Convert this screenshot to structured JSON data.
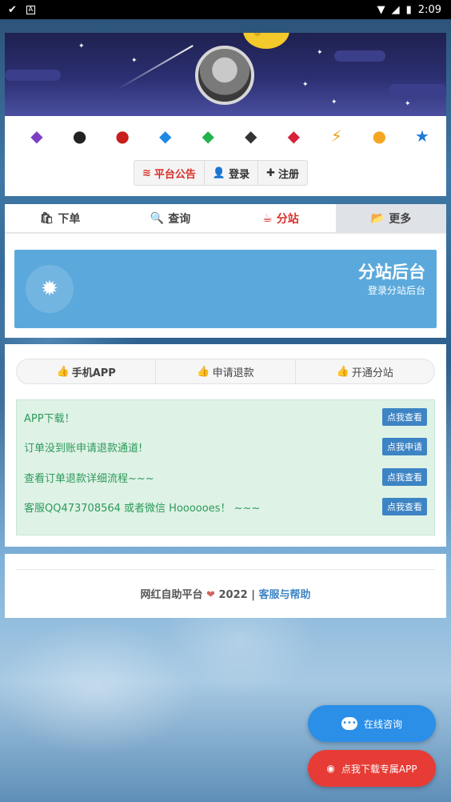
{
  "status_bar": {
    "time": "2:09"
  },
  "icons": {
    "qq_badges": [
      "qq-flame-icon",
      "qq-penguin-icon",
      "qq-red-penguin-icon",
      "superman-diamond-icon",
      "green-diamond-icon",
      "black-diamond-icon",
      "red-diamond-icon",
      "lightning-icon",
      "music-icon",
      "blue-star-icon"
    ]
  },
  "auth": {
    "notice": "平台公告",
    "login": "登录",
    "register": "注册"
  },
  "tabs": [
    {
      "label": "下单"
    },
    {
      "label": "查询"
    },
    {
      "label": "分站"
    },
    {
      "label": "更多"
    }
  ],
  "substation": {
    "title": "分站后台",
    "desc": "登录分站后台"
  },
  "pills": [
    {
      "label_bold": "手机APP",
      "prefix": ""
    },
    {
      "label": "申请退款"
    },
    {
      "label": "开通分站"
    }
  ],
  "notices": [
    {
      "text": "APP下载！",
      "button": "点我查看"
    },
    {
      "text": "订单没到账申请退款通道!",
      "button": "点我申请"
    },
    {
      "text": "查看订单退款详细流程~~~",
      "button": "点我查看"
    },
    {
      "text": "客服QQ473708564 或者微信 Hoooooes！ ~~~",
      "button": "点我查看"
    }
  ],
  "footer": {
    "brand": "网红自助平台",
    "year": "2022",
    "sep": "|",
    "help": "客服与帮助"
  },
  "floating": {
    "chat": "在线咨询",
    "app": "点我下载专属APP"
  },
  "colors": {
    "accent_red": "#d9302b",
    "blue": "#5ba9dc",
    "notice_green": "#2c9a5a",
    "chat_blue": "#2b8fe8",
    "app_red": "#e73b36"
  }
}
